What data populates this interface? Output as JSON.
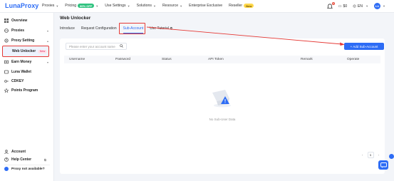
{
  "brand": {
    "name": "LunaProxy"
  },
  "nav": {
    "items": [
      {
        "label": "Proxies",
        "chevron": true
      },
      {
        "label": "Pricing",
        "badge": "80% OFF",
        "chevron": true
      },
      {
        "label": "Use Settings",
        "chevron": true
      },
      {
        "label": "Solutions",
        "chevron": true
      },
      {
        "label": "Resource",
        "chevron": true
      },
      {
        "label": "Enterprise Exclusive",
        "chevron": false
      },
      {
        "label": "Reseller",
        "badge": "New",
        "chevron": false
      }
    ],
    "notification_count": "8",
    "balance": "$0",
    "language": "EN",
    "avatar_initials": "LU"
  },
  "sidebar": {
    "items": [
      {
        "label": "Overview",
        "icon": "grid-icon"
      },
      {
        "label": "Proxies",
        "icon": "globe-icon",
        "expandable": true
      },
      {
        "label": "Proxy Setting",
        "icon": "gear-icon",
        "expandable": true
      },
      {
        "label": "Web Unlocker",
        "badge": "New",
        "sub": true
      },
      {
        "label": "Earn Money",
        "icon": "money-icon",
        "expandable": true
      },
      {
        "label": "Luna Wallet",
        "icon": "wallet-icon"
      },
      {
        "label": "CDKEY",
        "icon": "key-icon"
      },
      {
        "label": "Points Program",
        "icon": "star-icon"
      }
    ],
    "bottom": [
      {
        "label": "Account",
        "icon": "user-icon"
      },
      {
        "label": "Help Center",
        "icon": "help-icon"
      }
    ],
    "proxy_not_available": "Proxy not available?"
  },
  "main": {
    "title": "Web Unlocker",
    "tabs": [
      {
        "label": "Introduce"
      },
      {
        "label": "Request Configuration"
      },
      {
        "label": "Sub-Account",
        "active": true
      },
      {
        "label": "Use Tutorial"
      }
    ],
    "search_placeholder": "Please enter your account name",
    "add_button": "+ Add Sub-Account",
    "columns": [
      "Username",
      "Password",
      "Status",
      "API Token",
      "Remark",
      "Operate"
    ],
    "empty_text": "No Sub-User Data",
    "page": "1"
  },
  "colors": {
    "accent": "#2d6cf5",
    "highlight": "#e53935"
  }
}
